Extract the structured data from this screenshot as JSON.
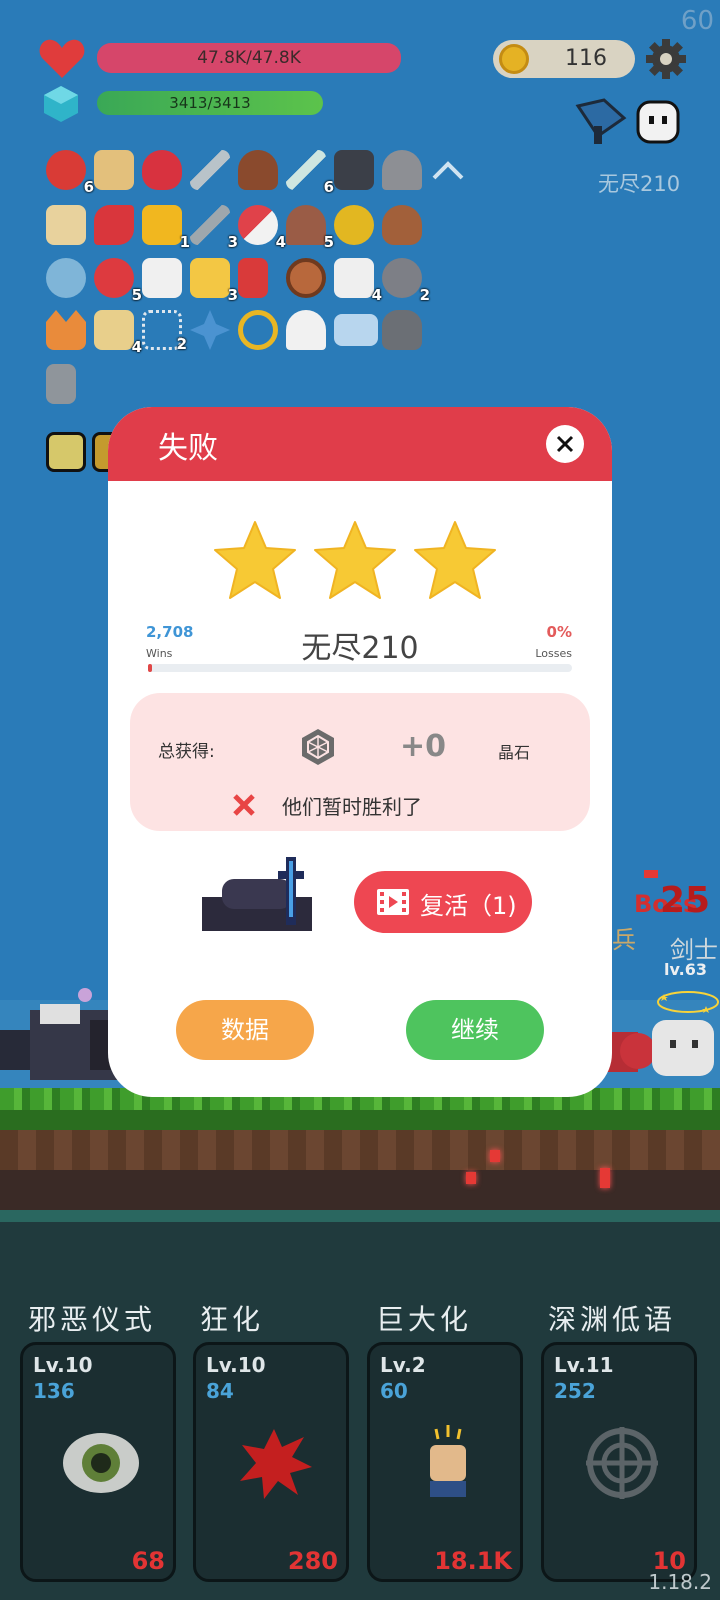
{
  "fps": "60",
  "version": "1.18.2",
  "hud": {
    "hp": "47.8K/47.8K",
    "mana": "3413/3413",
    "coins": "116",
    "level_label": "无尽210"
  },
  "inventory_counts": [
    "6",
    "6",
    "1",
    "3",
    "4",
    "5",
    "5",
    "3",
    "4",
    "2",
    "4",
    "2"
  ],
  "dialog": {
    "title": "失败",
    "stage": "无尽210",
    "wins_value": "2,708",
    "wins_label": "Wins",
    "losses_value": "0%",
    "losses_label": "Losses",
    "reward_label": "总获得:",
    "reward_value": "+0",
    "reward_unit": "晶石",
    "result_note": "他们暂时胜利了",
    "revive_label": "复活（1)",
    "stats_label": "数据",
    "continue_label": "继续",
    "stars_earned": 3,
    "progress_fraction": 0.01
  },
  "battle": {
    "boss_label": "Boss",
    "damage": "25",
    "enemy_name": "剑士",
    "enemy_level": "lv.63",
    "soldier_label": "兵"
  },
  "skills": [
    {
      "name": "邪恶仪式",
      "level": "Lv.10",
      "cost": "136",
      "value": "68",
      "icon": "eye-icon"
    },
    {
      "name": "狂化",
      "level": "Lv.10",
      "cost": "84",
      "value": "280",
      "icon": "splat-icon"
    },
    {
      "name": "巨大化",
      "level": "Lv.2",
      "cost": "60",
      "value": "18.1K",
      "icon": "fist-icon"
    },
    {
      "name": "深渊低语",
      "level": "Lv.11",
      "cost": "252",
      "value": "10",
      "icon": "crosshair-icon"
    }
  ],
  "colors": {
    "dialog_header": "#e03d4a",
    "revive": "#ee4752",
    "stats": "#f6a64a",
    "continue": "#4ec45e",
    "star": "#f7c934"
  }
}
